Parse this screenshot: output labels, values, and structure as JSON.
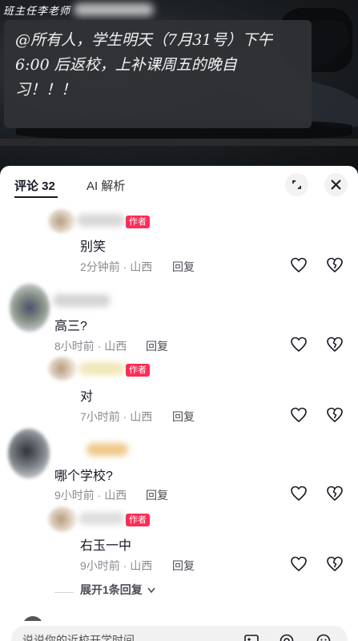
{
  "video": {
    "overlay_text": "班主任李老师",
    "note_lines": [
      "@所有人，学生明天（7月31号）下午",
      "6:00 后返校，上补课周五的晚自",
      "习！！！"
    ]
  },
  "sheet": {
    "tab_comments": "评论 32",
    "tab_ai": "AI 解析",
    "icons": {
      "expand": "expand-icon",
      "close": "close-icon",
      "like": "heart-icon",
      "dislike": "broken-heart-icon"
    }
  },
  "comments": [
    {
      "author_tag": "作者",
      "text": "别笑",
      "time": "2分钟前 · 山西",
      "reply": "回复"
    },
    {
      "text": "高三?",
      "time": "8小时前 · 山西",
      "reply": "回复"
    },
    {
      "author_tag": "作者",
      "text": "对",
      "time": "7小时前 · 山西",
      "reply": "回复"
    },
    {
      "text": "哪个学校?",
      "time": "9小时前 · 山西",
      "reply": "回复"
    },
    {
      "author_tag": "作者",
      "text": "右玉一中",
      "time": "9小时前 · 山西",
      "reply": "回复"
    }
  ],
  "expand_replies": "展开1条回复",
  "input": {
    "placeholder": "说说你的近校开学时间"
  },
  "colors": {
    "accent": "#fe2c55",
    "text": "#161823",
    "meta": "#8a8b91"
  }
}
